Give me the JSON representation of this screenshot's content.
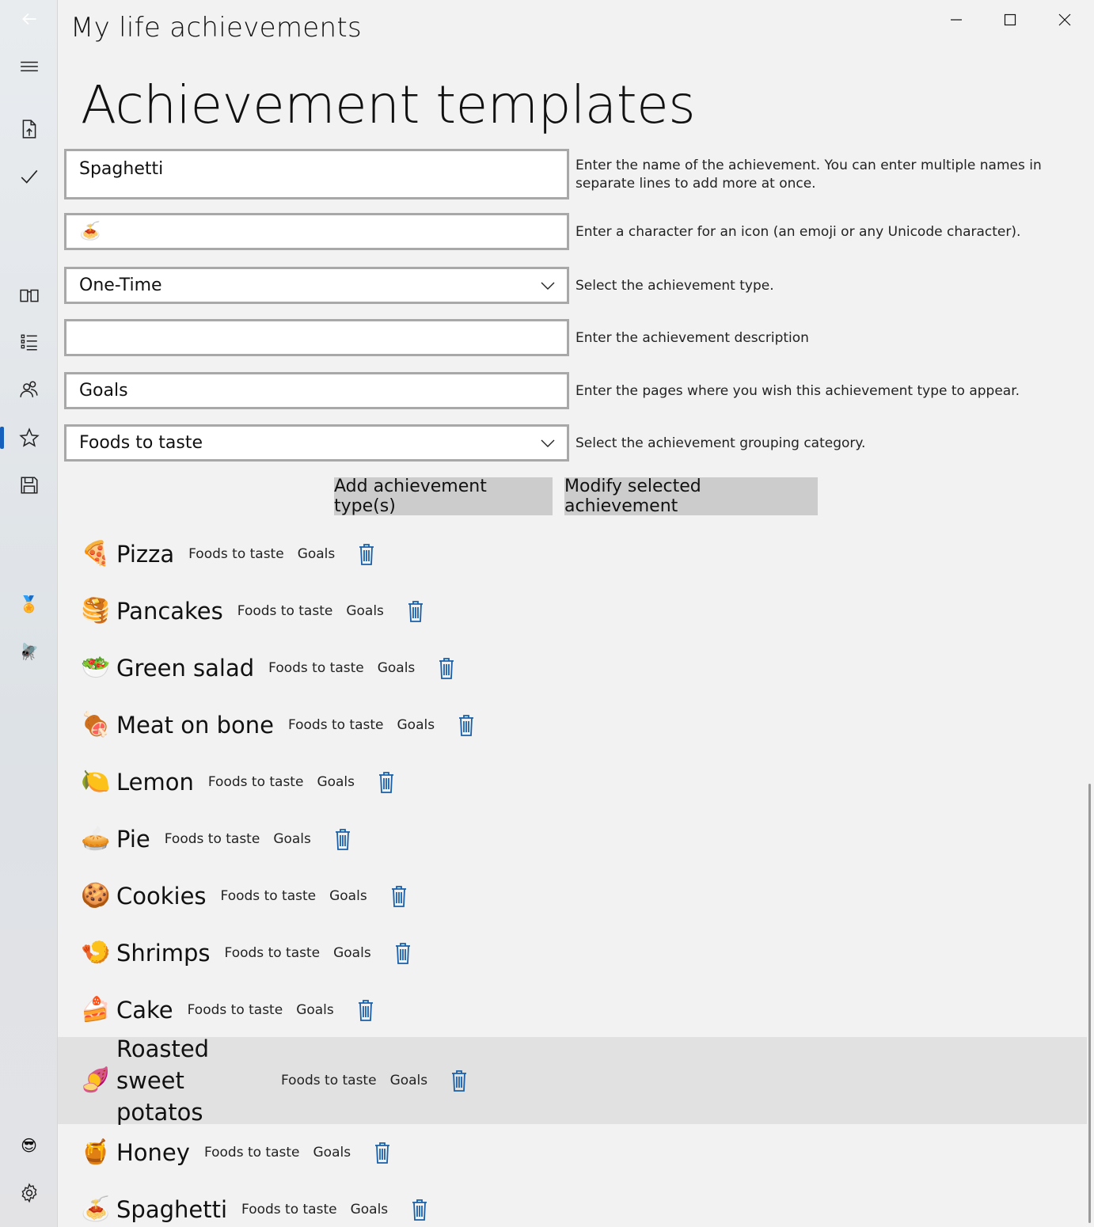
{
  "window": {
    "title": "My life achievements",
    "controls": [
      "minimize-icon",
      "maximize-icon",
      "close-icon"
    ]
  },
  "sidebar": {
    "items": [
      {
        "icon": "back-arrow-icon"
      },
      {
        "icon": "hamburger-menu-icon"
      },
      {
        "icon": "export-document-icon"
      },
      {
        "icon": "checkmark-icon"
      },
      {
        "icon": "open-book-icon"
      },
      {
        "icon": "bulleted-list-icon"
      },
      {
        "icon": "people-icon"
      },
      {
        "icon": "star-icon",
        "selected": true
      },
      {
        "icon": "save-icon"
      },
      {
        "icon": "medal-icon",
        "emoji": "🏅"
      },
      {
        "icon": "fly-icon",
        "emoji": "🪰"
      },
      {
        "icon": "sunglasses-face-icon",
        "emoji": "😎"
      },
      {
        "icon": "settings-gear-icon"
      }
    ]
  },
  "page": {
    "title": "Achievement templates"
  },
  "form": {
    "name_value": "Spaghetti",
    "name_hint": "Enter the name of the achievement. You can enter multiple names in separate lines to add more at once.",
    "icon_value": "🍝",
    "icon_hint": "Enter a character for an icon (an emoji or any Unicode character).",
    "type_value": "One-Time",
    "type_hint": "Select the achievement type.",
    "description_value": "",
    "description_hint": "Enter the achievement description",
    "pages_value": "Goals",
    "pages_hint": "Enter the pages where you wish this achievement type to appear.",
    "category_value": "Foods to taste",
    "category_hint": "Select the achievement grouping category."
  },
  "buttons": {
    "add_label": "Add achievement type(s)",
    "modify_label": "Modify selected achievement"
  },
  "achievements": [
    {
      "icon": "🍕",
      "name": "Pizza",
      "category": "Foods to taste",
      "pages": "Goals"
    },
    {
      "icon": "🥞",
      "name": "Pancakes",
      "category": "Foods to taste",
      "pages": "Goals"
    },
    {
      "icon": "🥗",
      "name": "Green salad",
      "category": "Foods to taste",
      "pages": "Goals"
    },
    {
      "icon": "🍖",
      "name": "Meat on bone",
      "category": "Foods to taste",
      "pages": "Goals"
    },
    {
      "icon": "🍋",
      "name": "Lemon",
      "category": "Foods to taste",
      "pages": "Goals"
    },
    {
      "icon": "🥧",
      "name": "Pie",
      "category": "Foods to taste",
      "pages": "Goals"
    },
    {
      "icon": "🍪",
      "name": "Cookies",
      "category": "Foods to taste",
      "pages": "Goals"
    },
    {
      "icon": "🍤",
      "name": "Shrimps",
      "category": "Foods to taste",
      "pages": "Goals"
    },
    {
      "icon": "🍰",
      "name": "Cake",
      "category": "Foods to taste",
      "pages": "Goals"
    },
    {
      "icon": "🍠",
      "name": "Roasted sweet potatos",
      "category": "Foods to taste",
      "pages": "Goals",
      "selected": true
    },
    {
      "icon": "🍯",
      "name": "Honey",
      "category": "Foods to taste",
      "pages": "Goals"
    },
    {
      "icon": "🍝",
      "name": "Spaghetti",
      "category": "Foods to taste",
      "pages": "Goals"
    }
  ],
  "colors": {
    "accent": "#1560bd",
    "delete_icon": "#1a5fa8",
    "selected_row": "#e1e1e1",
    "button_bg": "#cccccc"
  }
}
